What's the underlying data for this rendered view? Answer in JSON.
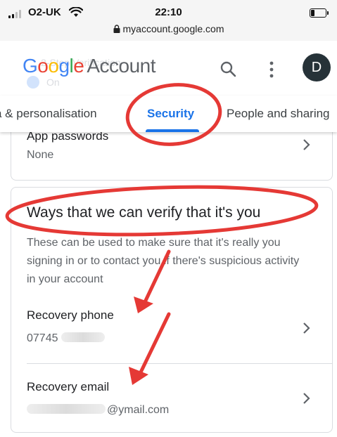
{
  "status_bar": {
    "carrier": "O2-UK",
    "time": "22:10",
    "url": "myaccount.google.com"
  },
  "header": {
    "logo_letters": [
      "G",
      "o",
      "o",
      "g",
      "l",
      "e"
    ],
    "logo_product": "Account",
    "avatar_initial": "D",
    "ghost_title": "2-Step Verification",
    "ghost_status": "On"
  },
  "tabs": [
    {
      "label": "a & personalisation"
    },
    {
      "label": "Security"
    },
    {
      "label": "People and sharing"
    }
  ],
  "app_passwords": {
    "label": "App passwords",
    "value": "None"
  },
  "verify": {
    "title": "Ways that we can verify that it's you",
    "description": "These can be used to make sure that it's really you signing in or to contact you if there's suspicious activity in your account",
    "recovery_phone": {
      "label": "Recovery phone",
      "value_prefix": "07745"
    },
    "recovery_email": {
      "label": "Recovery email",
      "value_suffix": "@ymail.com"
    }
  },
  "colors": {
    "accent": "#1a73e8",
    "annotation": "#e53935",
    "google_blue": "#4285f4",
    "google_red": "#ea4335",
    "google_yellow": "#fbbc05",
    "google_green": "#34a853"
  },
  "icons": [
    "wifi-icon",
    "lock-icon",
    "search-icon",
    "more-vert-icon",
    "chevron-right-icon",
    "battery-icon",
    "signal-icon"
  ]
}
